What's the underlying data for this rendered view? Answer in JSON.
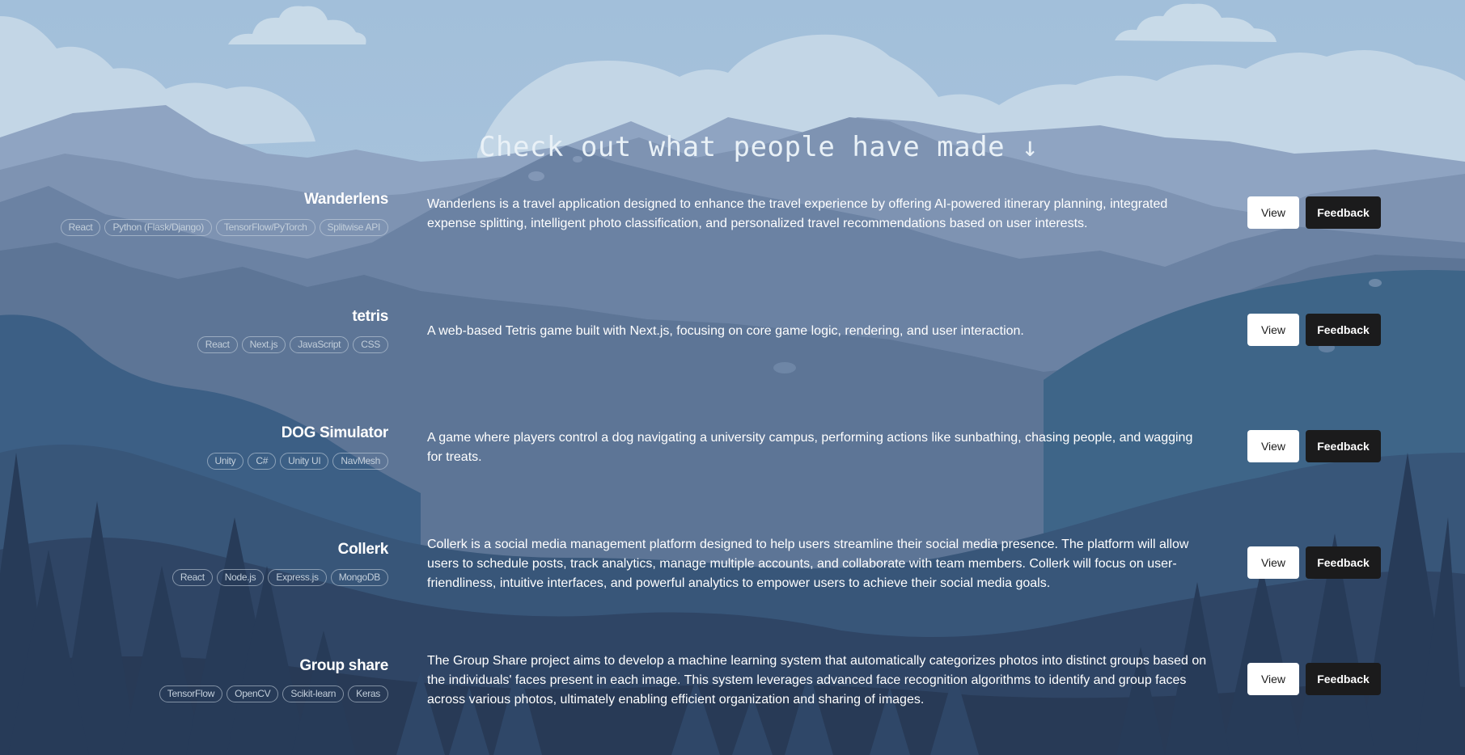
{
  "heading": "Check out what people have made ↓",
  "buttons": {
    "view_label": "View",
    "feedback_label": "Feedback"
  },
  "colors": {
    "sky": "#a7c3dc",
    "feedback_button": "#1b1b1c",
    "view_button": "#ffffff"
  },
  "projects": [
    {
      "name": "Wanderlens",
      "tags": [
        "React",
        "Python (Flask/Django)",
        "TensorFlow/PyTorch",
        "Splitwise API"
      ],
      "description": "Wanderlens is a travel application designed to enhance the travel experience by offering AI-powered itinerary planning, integrated expense splitting, intelligent photo classification, and personalized travel recommendations based on user interests."
    },
    {
      "name": "tetris",
      "tags": [
        "React",
        "Next.js",
        "JavaScript",
        "CSS"
      ],
      "description": "A web-based Tetris game built with Next.js, focusing on core game logic, rendering, and user interaction."
    },
    {
      "name": "DOG Simulator",
      "tags": [
        "Unity",
        "C#",
        "Unity UI",
        "NavMesh"
      ],
      "description": "A game where players control a dog navigating a university campus, performing actions like sunbathing, chasing people, and wagging for treats."
    },
    {
      "name": "Collerk",
      "tags": [
        "React",
        "Node.js",
        "Express.js",
        "MongoDB"
      ],
      "description": "Collerk is a social media management platform designed to help users streamline their social media presence. The platform will allow users to schedule posts, track analytics, manage multiple accounts, and collaborate with team members. Collerk will focus on user-friendliness, intuitive interfaces, and powerful analytics to empower users to achieve their social media goals."
    },
    {
      "name": "Group share",
      "tags": [
        "TensorFlow",
        "OpenCV",
        "Scikit-learn",
        "Keras"
      ],
      "description": "The Group Share project aims to develop a machine learning system that automatically categorizes photos into distinct groups based on the individuals' faces present in each image. This system leverages advanced face recognition algorithms to identify and group faces across various photos, ultimately enabling efficient organization and sharing of images."
    }
  ]
}
